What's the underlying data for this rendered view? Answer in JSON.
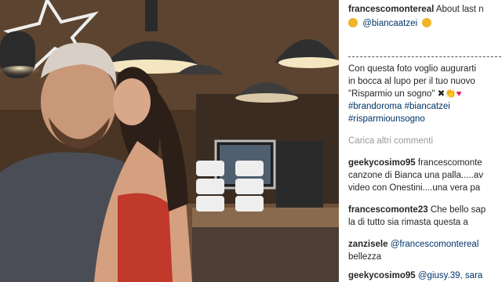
{
  "post": {
    "username": "francescomontereal",
    "caption_start": "About last n",
    "mention": "@biancaatzei",
    "body_lines": [
      "Con questa foto voglio augurarti",
      "in bocca al lupo per il tuo nuovo",
      "\"Risparmio un sogno\""
    ],
    "hashtags_line1": [
      "#brandoroma",
      "#biancatzei"
    ],
    "hashtag_line2": "#risparmiounsogno"
  },
  "load_more": "Carica altri commenti",
  "comments": [
    {
      "user": "geekycosimo95",
      "text": "francescomonte",
      "lines": [
        "canzone di Bianca una palla.....av",
        "video con Onestini....una vera pa"
      ]
    },
    {
      "user": "francescomonte23",
      "text": "Che bello sap",
      "lines": [
        "la di tutto sia rimasta questa a"
      ]
    },
    {
      "user": "zanzisele",
      "text": "@francescomontereal",
      "lines": [
        "bellezza"
      ]
    },
    {
      "user": "geekycosimo95",
      "text": "@giusy.39, sara"
    }
  ],
  "colors": {
    "link": "#003569",
    "username": "#262626",
    "muted": "#999999"
  }
}
